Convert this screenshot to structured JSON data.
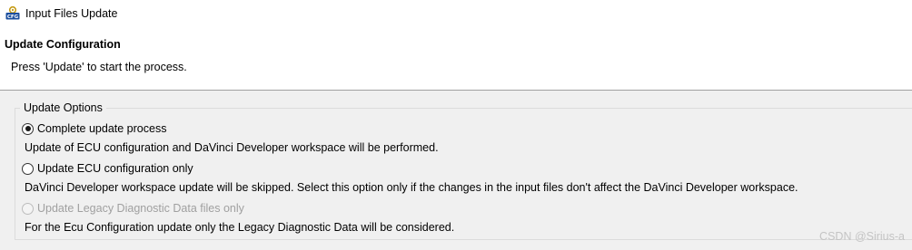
{
  "window": {
    "title": "Input Files Update",
    "icon": "cfg-icon",
    "icon_text": "CFG"
  },
  "header": {
    "title": "Update Configuration",
    "description": "Press 'Update' to start the process."
  },
  "update_options": {
    "legend": "Update Options",
    "options": [
      {
        "label": "Complete update process",
        "selected": true,
        "enabled": true,
        "description": "Update of ECU configuration and DaVinci Developer workspace will be performed."
      },
      {
        "label": "Update ECU configuration only",
        "selected": false,
        "enabled": true,
        "description": "DaVinci Developer workspace update will be skipped. Select this option only if the changes in the input files don't affect the DaVinci Developer workspace."
      },
      {
        "label": "Update Legacy Diagnostic Data files only",
        "selected": false,
        "enabled": false,
        "description": "For the Ecu Configuration update only the Legacy Diagnostic Data will be considered."
      }
    ]
  },
  "watermark": "CSDN @Sirius-a",
  "colors": {
    "content_background": "#f0f0f0",
    "header_background": "#ffffff",
    "disabled_text": "#a0a0a0"
  }
}
